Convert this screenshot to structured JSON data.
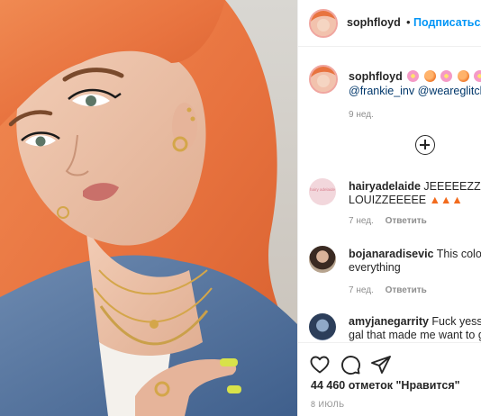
{
  "header": {
    "username": "sophfloyd",
    "separator": "•",
    "follow_label": "Подписаться"
  },
  "caption": {
    "username": "sophfloyd",
    "emoji_icons": [
      "cherry-blossom-icon",
      "peach-icon",
      "cherry-blossom-icon",
      "peach-icon",
      "cherry-blossom-icon"
    ],
    "mentions": "@frankie_inv @weareglitchc",
    "time": "9 нед."
  },
  "comments": [
    {
      "username": "hairyadelaide",
      "text_line1": "JEEEEEZZEEE",
      "text_line2": "LOUIZZEEEEE",
      "emoji_icons": [
        "fire-icon",
        "fire-icon",
        "fire-icon"
      ],
      "avatar_text": "hairy adelaide",
      "time": "7 нед.",
      "reply_label": "Ответить"
    },
    {
      "username": "bojanaradisevic",
      "text_line1": "This colou",
      "text_line2": "everything",
      "time": "7 нед.",
      "reply_label": "Ответить"
    },
    {
      "username": "amyjanegarrity",
      "text_line1": "Fuck yesss",
      "text_line2": "gal that made me want to g"
    }
  ],
  "actions": {
    "icons": [
      "heart-icon",
      "comment-icon",
      "share-icon"
    ],
    "likes_text": "44 460 отметок \"Нравится\"",
    "date": "8 ИЮЛЬ"
  },
  "colors": {
    "accent": "#0095f6",
    "muted": "#8e8e8e",
    "hair": "#e8733f"
  }
}
